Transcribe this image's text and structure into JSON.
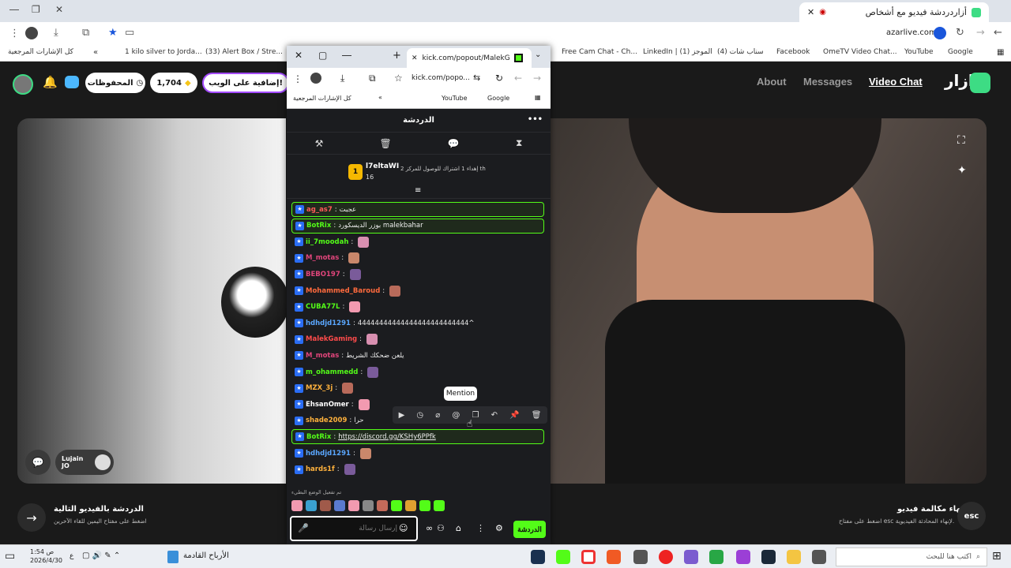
{
  "browser": {
    "tab_title": "أزاردردشة فيديو مع أشخاص",
    "address": "azarlive.com",
    "bookmarks": [
      {
        "label": "Google"
      },
      {
        "label": "YouTube"
      },
      {
        "label": "OmeTV Video Chat..."
      },
      {
        "label": "Facebook"
      },
      {
        "label": "(4) سناب شات"
      },
      {
        "label": "LinkedIn | (1) الموجز"
      },
      {
        "label": "Free Cam Chat - Ch..."
      },
      {
        "label": "(33) Alert Box / Stre..."
      },
      {
        "label": "1 kilo silver to Jorda..."
      },
      {
        "label": "كل الإشارات المرجعية"
      }
    ]
  },
  "nav": {
    "about": "About",
    "messages": "Messages",
    "video_chat": "Video Chat",
    "logo": "ازار",
    "saved": "المحفوظات",
    "gems": "1,704",
    "promo": "إضافية على الويب!"
  },
  "left_video": {
    "user": "Lujain",
    "country": "JO"
  },
  "bottom": {
    "next_title": "الدردشة بالفيديو التالية",
    "next_hint": "اضغط على مفتاح اليمين للقاء الآخرين",
    "end_title": "إنهاء مكالمة فيديو",
    "end_hint": "اضغط على مفتاح esc لإنهاء المحادثة الفيديوية.",
    "esc": "esc"
  },
  "popup": {
    "tab_title": "kick.com/popout/MalekGaming",
    "address": "kick.com/popo...",
    "bm_youtube": "YouTube",
    "bm_google": "Google",
    "bm_all": "كل الإشارات المرجعية",
    "chat_title": "الدردشة",
    "pinned": {
      "user": "l7eltaWI",
      "rank": "1",
      "count": "16",
      "text": "إهداء 1 اشتراك للوصول للمركز 2 th"
    },
    "messages": [
      {
        "user": "ag_as7",
        "text": "عجبت",
        "color": "#ff5a5a",
        "hl": true
      },
      {
        "user": "BotRix",
        "text": "بوزر الديسكورد malekbahar",
        "color": "#53fc18",
        "hl": true
      },
      {
        "user": "ii_7moodah",
        "text": "",
        "color": "#53fc18"
      },
      {
        "user": "M_motas",
        "text": "",
        "color": "#e0457b"
      },
      {
        "user": "BEBO197",
        "text": "",
        "color": "#e0457b"
      },
      {
        "user": "Mohammed_Baroud",
        "text": "",
        "color": "#ff6a3d"
      },
      {
        "user": "CUBA77L",
        "text": "",
        "color": "#53fc18"
      },
      {
        "user": "hdhdjd1291",
        "text": "44444444444444444444444444^",
        "color": "#5aa7ff"
      },
      {
        "user": "MalekGaming",
        "text": "",
        "color": "#ff4b4b"
      },
      {
        "user": "M_motas",
        "text": "يلعن ضحكك الشريط",
        "color": "#e0457b"
      },
      {
        "user": "m_ohammedd",
        "text": "",
        "color": "#53fc18"
      },
      {
        "user": "MZX_3j",
        "text": "",
        "color": "#ffb23d"
      },
      {
        "user": "EhsanOmer",
        "text": "",
        "color": "#fff"
      },
      {
        "user": "shade2009",
        "text": "حرا",
        "color": "#ffb23d"
      },
      {
        "user": "BotRix",
        "text": "https://discord.gg/KSHy6PPfk",
        "color": "#53fc18",
        "hl": true
      },
      {
        "user": "hdhdjd1291",
        "text": "",
        "color": "#5aa7ff"
      },
      {
        "user": "hards1f",
        "text": "",
        "color": "#ffb23d"
      }
    ],
    "tooltip": "Mention",
    "slow_mode": "تم تفعيل الوضع البطيء",
    "input_placeholder": "إرسال رسالة",
    "send": "الدردشة"
  },
  "taskbar": {
    "time": "1:54 ص",
    "date": "2026/4/30",
    "lang": "ع",
    "news": "الأرباح القادمة",
    "search": "اكتب هنا للبحث"
  },
  "colors": {
    "kick_green": "#53fc18",
    "azar_green": "#3ddc84"
  }
}
